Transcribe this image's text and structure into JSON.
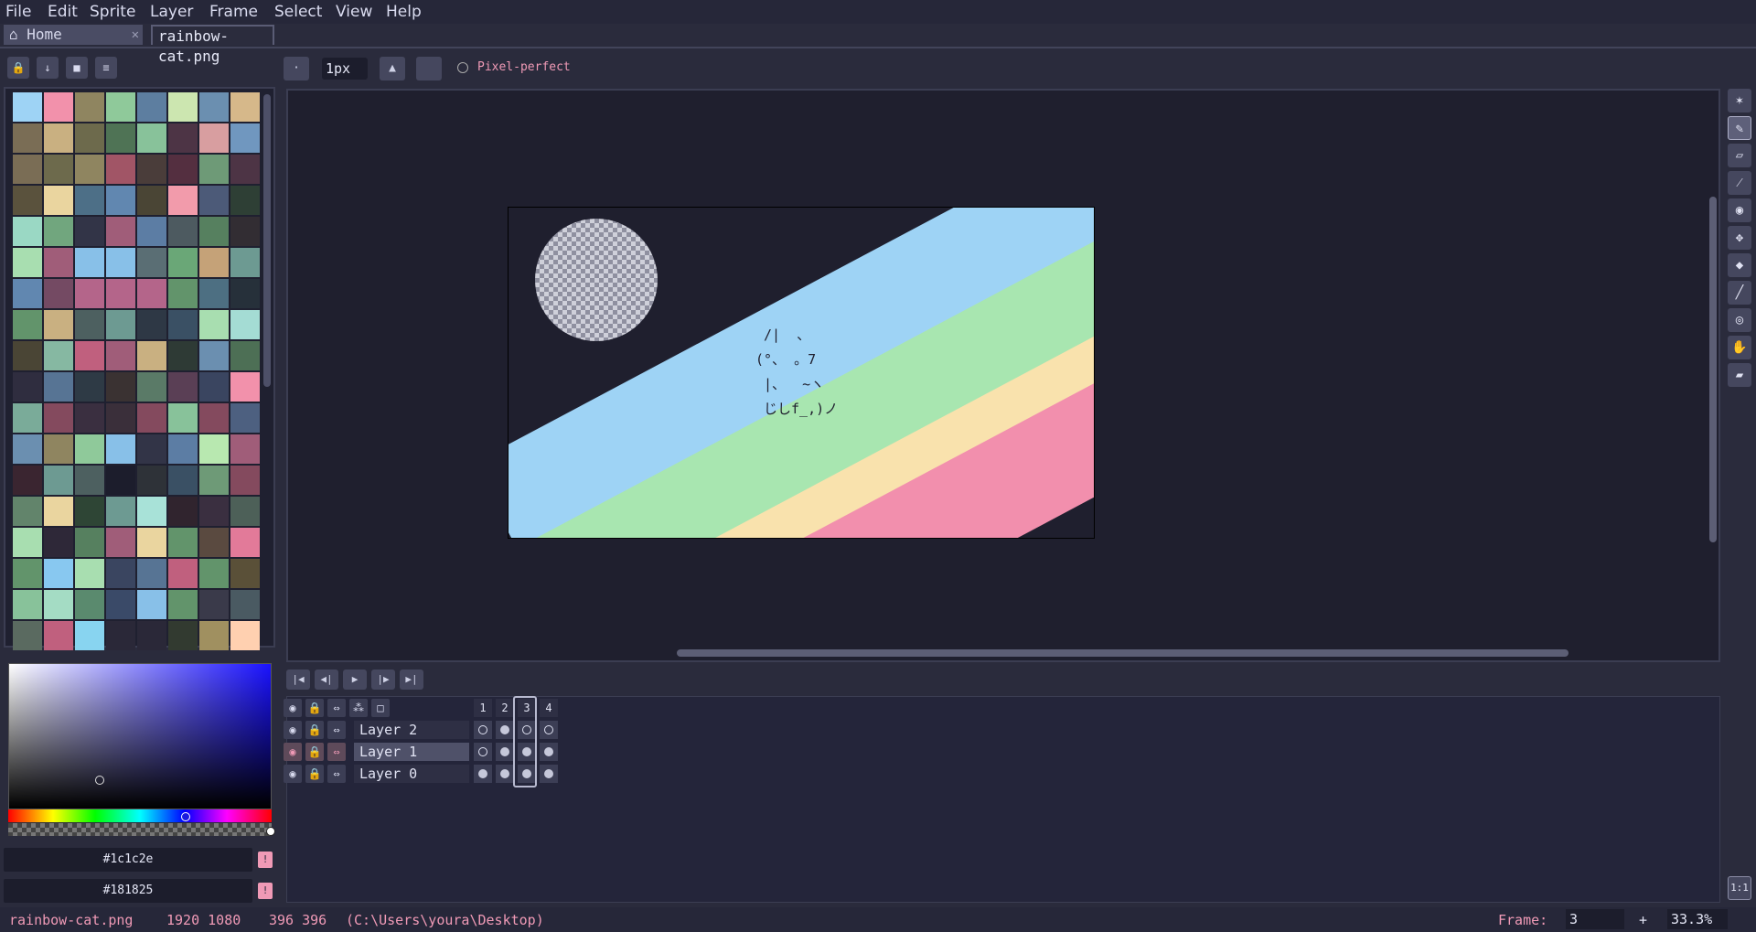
{
  "menu": [
    "File",
    "Edit",
    "Sprite",
    "Layer",
    "Frame",
    "Select",
    "View",
    "Help"
  ],
  "tabs": {
    "home": "Home",
    "document": "rainbow-cat.png"
  },
  "palette_tools": [
    "lock-icon",
    "arrow-down-icon",
    "bookmark-icon",
    "menu-icon"
  ],
  "palette_colors": [
    "#9ed3f5",
    "#f291ab",
    "#8f8560",
    "#8fc99a",
    "#5d7ea0",
    "#cce6b0",
    "#6b8fb0",
    "#d6b88a",
    "#7a6d55",
    "#c9b081",
    "#6d6a4c",
    "#4f7355",
    "#88c29a",
    "#4d3445",
    "#d89ea0",
    "#7097bf",
    "#7a6d55",
    "#6d6a4c",
    "#8f8560",
    "#a15566",
    "#4a3d3a",
    "#542f40",
    "#6e9a77",
    "#4d3445",
    "#5a523d",
    "#ead59f",
    "#4d6f87",
    "#6187b0",
    "#4a4535",
    "#f29bab",
    "#4c5a78",
    "#2e3f35",
    "#9ad8c4",
    "#71a67e",
    "#323447",
    "#a05d79",
    "#5c7da4",
    "#4d5a60",
    "#56805f",
    "#322d33",
    "#a8deb0",
    "#a05d79",
    "#88c0e8",
    "#88c0e8",
    "#5a6e74",
    "#6aa777",
    "#c5a278",
    "#6d9a92",
    "#6187b0",
    "#744a63",
    "#b4658a",
    "#b4658a",
    "#b4658a",
    "#62946b",
    "#4d6f82",
    "#26303a",
    "#62946b",
    "#c9b081",
    "#4d6060",
    "#6d9a92",
    "#2e3845",
    "#3a5064",
    "#a8deb0",
    "#a4dcd4",
    "#4a4535",
    "#86b8a2",
    "#c0607e",
    "#a05d79",
    "#c9b081",
    "#2e3a35",
    "#6b8fb0",
    "#4d6f55",
    "#2f2d3f",
    "#577494",
    "#2e3a45",
    "#3a3232",
    "#5a7a67",
    "#5a3f55",
    "#3a4560",
    "#f291ab",
    "#7aab99",
    "#844a5e",
    "#3a2f40",
    "#3a2f3a",
    "#844a5e",
    "#88c29a",
    "#844a5e",
    "#4d6080",
    "#6b8fb0",
    "#8f8560",
    "#8fc99a",
    "#88c0e8",
    "#323447",
    "#5c7da4",
    "#b8e8b0",
    "#a05d79",
    "#3a2530",
    "#6d9a92",
    "#4d6060",
    "#1c1d2c",
    "#2e3238",
    "#3a5064",
    "#6e9a77",
    "#844a5e",
    "#62846b",
    "#ead59f",
    "#2e4535",
    "#6d9a92",
    "#a8e2d8",
    "#30242e",
    "#3a2f40",
    "#4d6058",
    "#a8deb0",
    "#2e2838",
    "#56805f",
    "#a05d79",
    "#ead59f",
    "#62946b",
    "#5a4a40",
    "#e27a99",
    "#62946b",
    "#88c8f0",
    "#a8deb0",
    "#3a4560",
    "#577494",
    "#c0607e",
    "#62946b",
    "#5a5038",
    "#88c29a",
    "#a4dcc4",
    "#5a8a6e",
    "#3a4a68",
    "#88c0e8",
    "#62946b",
    "#3a3a4a",
    "#4a5a62",
    "#5a6a60",
    "#c0607e",
    "#88d4f0",
    "#2a2838",
    "#2a2838",
    "#323a30",
    "#a09060",
    "#ffd0b0"
  ],
  "color_picker": {
    "primary_hex": "#1c1c2e",
    "secondary_hex": "#181825"
  },
  "brush": {
    "size": "1px",
    "pixel_perfect_label": "Pixel-perfect"
  },
  "sprite": {
    "background": "#1f1f2e",
    "stripe_colors": [
      "#9ed3f5",
      "#a8e6b0",
      "#f9e2ad",
      "#f28fad"
    ],
    "cat_lines": [
      " /|  、",
      "(°、 。7",
      " |、  ~ヽ",
      " じしf_,)ノ"
    ]
  },
  "tools": [
    "magic-wand-icon",
    "pencil-icon",
    "eraser-icon",
    "eyedropper-icon",
    "zoom-icon",
    "move-icon",
    "paint-bucket-icon",
    "line-icon",
    "eye-icon",
    "hand-icon",
    "ruler-icon"
  ],
  "timeline": {
    "frames": [
      "1",
      "2",
      "3",
      "4"
    ],
    "active_frame": "3",
    "layers": [
      {
        "name": "Layer 2",
        "cels": [
          "empty",
          "filled",
          "empty",
          "empty"
        ],
        "selected": false
      },
      {
        "name": "Layer 1",
        "cels": [
          "empty",
          "filled",
          "filled",
          "filled"
        ],
        "selected": true
      },
      {
        "name": "Layer 0",
        "cels": [
          "filled",
          "filled",
          "filled",
          "filled"
        ],
        "selected": false
      }
    ]
  },
  "zoom_reset_label": "1:1",
  "status": {
    "filename": "rainbow-cat.png",
    "size": "1920 1080",
    "cursor": "396 396",
    "path": "(C:\\Users\\youra\\Desktop)",
    "frame_label": "Frame:",
    "frame_value": "3",
    "zoom": "33.3%"
  }
}
